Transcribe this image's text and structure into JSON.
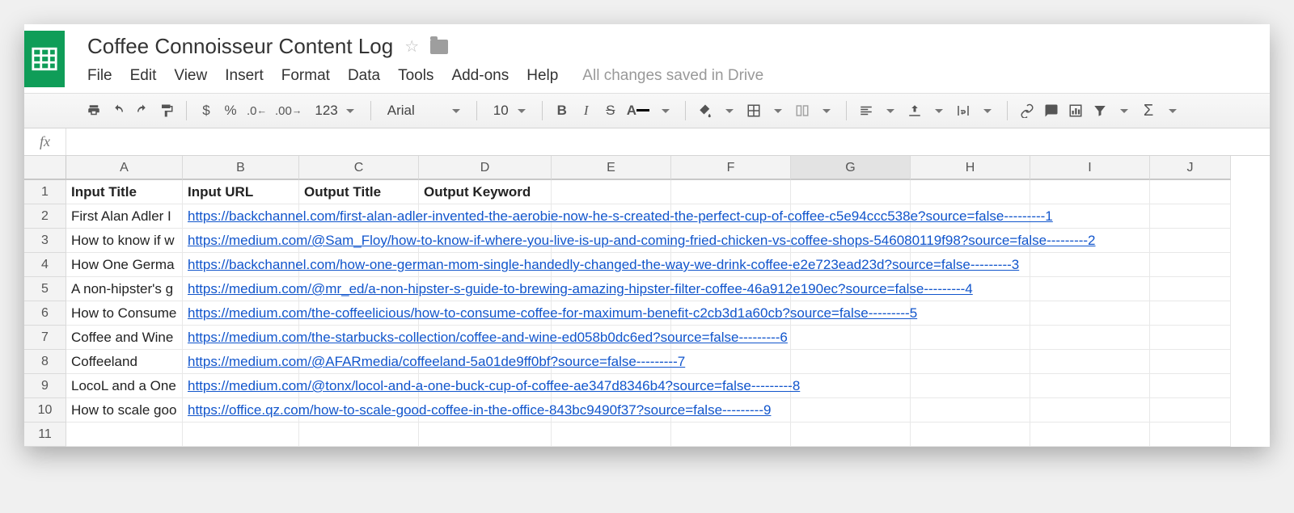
{
  "doc_title": "Coffee Connoisseur Content Log",
  "menu": {
    "items": [
      "File",
      "Edit",
      "View",
      "Insert",
      "Format",
      "Data",
      "Tools",
      "Add-ons",
      "Help"
    ],
    "save_status": "All changes saved in Drive"
  },
  "toolbar": {
    "currency": "$",
    "percent": "%",
    "dec_dec": ".0",
    "inc_dec": ".00",
    "number_format": "123",
    "font": "Arial",
    "font_size": "10",
    "bold": "B",
    "italic": "I",
    "strike": "S",
    "text_color": "A",
    "sigma": "Σ"
  },
  "formula_bar": {
    "fx_label": "fx",
    "value": ""
  },
  "columns": [
    "A",
    "B",
    "C",
    "D",
    "E",
    "F",
    "G",
    "H",
    "I",
    "J"
  ],
  "selected_column": "G",
  "headers": {
    "input_title": "Input Title",
    "input_url": "Input URL",
    "output_title": "Output Title",
    "output_keyword": "Output Keyword"
  },
  "rows": [
    {
      "title": "First Alan Adler I",
      "url": "https://backchannel.com/first-alan-adler-invented-the-aerobie-now-he-s-created-the-perfect-cup-of-coffee-c5e94ccc538e?source=false---------1"
    },
    {
      "title": "How to know if w",
      "url": "https://medium.com/@Sam_Floy/how-to-know-if-where-you-live-is-up-and-coming-fried-chicken-vs-coffee-shops-546080119f98?source=false---------2"
    },
    {
      "title": "How One Germa",
      "url": "https://backchannel.com/how-one-german-mom-single-handedly-changed-the-way-we-drink-coffee-e2e723ead23d?source=false---------3"
    },
    {
      "title": "A non-hipster's g",
      "url": "https://medium.com/@mr_ed/a-non-hipster-s-guide-to-brewing-amazing-hipster-filter-coffee-46a912e190ec?source=false---------4"
    },
    {
      "title": "How to Consume",
      "url": "https://medium.com/the-coffeelicious/how-to-consume-coffee-for-maximum-benefit-c2cb3d1a60cb?source=false---------5"
    },
    {
      "title": "Coffee and Wine",
      "url": "https://medium.com/the-starbucks-collection/coffee-and-wine-ed058b0dc6ed?source=false---------6"
    },
    {
      "title": "Coffeeland",
      "url": "https://medium.com/@AFARmedia/coffeeland-5a01de9ff0bf?source=false---------7"
    },
    {
      "title": "LocoL and a One",
      "url": "https://medium.com/@tonx/locol-and-a-one-buck-cup-of-coffee-ae347d8346b4?source=false---------8"
    },
    {
      "title": "How to scale goo",
      "url": "https://office.qz.com/how-to-scale-good-coffee-in-the-office-843bc9490f37?source=false---------9"
    }
  ],
  "row_numbers": [
    "1",
    "2",
    "3",
    "4",
    "5",
    "6",
    "7",
    "8",
    "9",
    "10",
    "11"
  ]
}
